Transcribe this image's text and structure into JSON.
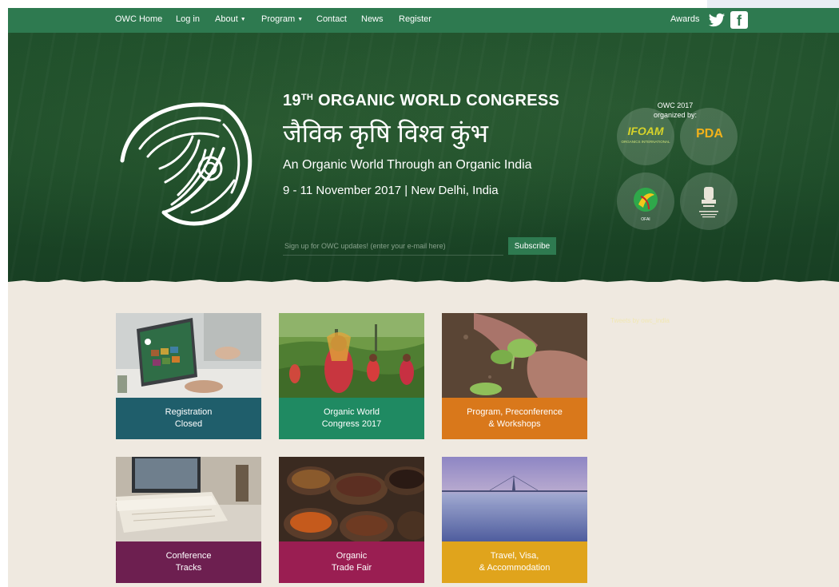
{
  "nav": {
    "items": [
      {
        "label": "OWC Home",
        "caret": false
      },
      {
        "label": "Log in",
        "caret": false
      },
      {
        "label": "About",
        "caret": true
      },
      {
        "label": "Program",
        "caret": true
      },
      {
        "label": "Contact",
        "caret": false
      },
      {
        "label": "News",
        "caret": false
      },
      {
        "label": "Register",
        "caret": false
      }
    ],
    "awards": "Awards",
    "fb_glyph": "f"
  },
  "hero": {
    "title_num": "19",
    "title_sup": "TH",
    "title_rest": " ORGANIC WORLD CONGRESS",
    "hindi": "जैविक कृषि विश्व कुंभ",
    "tagline": "An Organic World Through an Organic India",
    "dates": "9 - 11 November 2017  |  New Delhi, India",
    "signup_placeholder": "Sign up for OWC updates! (enter your e-mail here)",
    "subscribe_label": "Subscribe"
  },
  "organizers": {
    "label_line1": "OWC 2017",
    "label_line2": "organized by:",
    "logos": [
      {
        "name": "IFOAM",
        "text": "IFOAM",
        "sub": "ORGANICS INTERNATIONAL"
      },
      {
        "name": "PDA",
        "text": "PDA"
      },
      {
        "name": "OFAI",
        "text": "OFAI"
      },
      {
        "name": "Ministry emblem"
      }
    ]
  },
  "sidebar": {
    "twitter_link": "Tweets by owc_india"
  },
  "tiles": [
    {
      "label": "Registration\nClosed",
      "band_color": "#1f5e6b"
    },
    {
      "label": "Organic World\nCongress 2017",
      "band_color": "#1f8a62"
    },
    {
      "label": "Program, Preconference\n& Workshops",
      "band_color": "#d9781b"
    },
    {
      "label": "Conference\nTracks",
      "band_color": "#6d1f50"
    },
    {
      "label": "Organic\nTrade Fair",
      "band_color": "#9a1e52"
    },
    {
      "label": "Travel, Visa,\n& Accommodation",
      "band_color": "#e0a41c"
    }
  ],
  "colors": {
    "nav_bg": "#2e7a50",
    "hero_bg": "#1c4a28",
    "page_bg": "#efe9e0"
  }
}
